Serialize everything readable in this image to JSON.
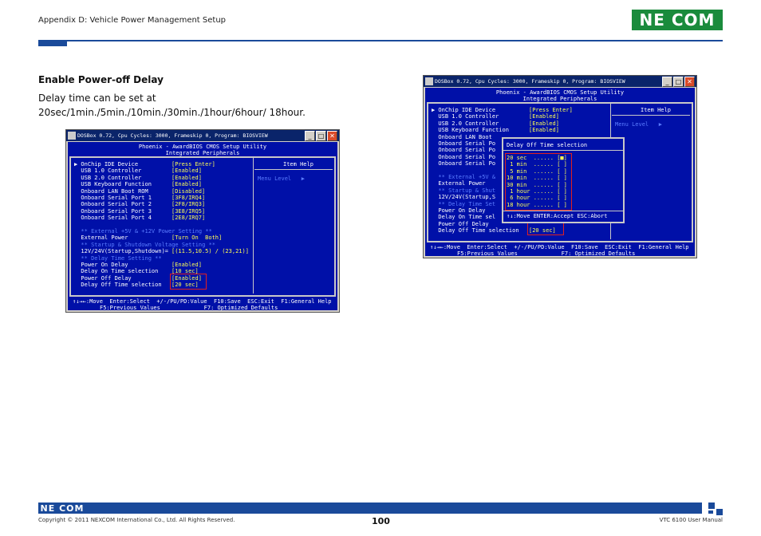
{
  "header": {
    "section": "Appendix D: Vehicle Power Management Setup",
    "logo_text": "NE COM",
    "logo_x": "X"
  },
  "content": {
    "title": "Enable Power-off Delay",
    "body": "Delay time can be set at 20sec/1min./5min./10min./30min./1hour/6hour/ 18hour."
  },
  "dos_window": {
    "title": "DOSBox 0.72, Cpu Cycles:   3000, Frameskip 0, Program: BIOSVIEW",
    "bios_title": "Phoenix - AwardBIOS CMOS Setup Utility",
    "bios_subtitle": "Integrated Peripherals",
    "item_help": "Item Help",
    "menu_level": "Menu Level   ▶",
    "help1": "↑↓→←:Move  Enter:Select  +/-/PU/PD:Value  F10:Save  ESC:Exit  F1:General Help",
    "help2": "F5:Previous Values             F7: Optimized Defaults"
  },
  "left_items": [
    {
      "label": "▶ OnChip IDE Device",
      "value": "[Press Enter]",
      "lcolor": "white",
      "vcolor": "yellow"
    },
    {
      "label": "  USB 1.0 Controller",
      "value": "[Enabled]",
      "lcolor": "white",
      "vcolor": "yellow"
    },
    {
      "label": "  USB 2.0 Controller",
      "value": "[Enabled]",
      "lcolor": "white",
      "vcolor": "yellow"
    },
    {
      "label": "  USB Keyboard Function",
      "value": "[Enabled]",
      "lcolor": "white",
      "vcolor": "yellow"
    },
    {
      "label": "  Onboard LAN Boot ROM",
      "value": "[Disabled]",
      "lcolor": "white",
      "vcolor": "yellow"
    },
    {
      "label": "  Onboard Serial Port 1",
      "value": "[3F8/IRQ4]",
      "lcolor": "white",
      "vcolor": "yellow"
    },
    {
      "label": "  Onboard Serial Port 2",
      "value": "[2F8/IRQ3]",
      "lcolor": "white",
      "vcolor": "yellow"
    },
    {
      "label": "  Onboard Serial Port 3",
      "value": "[3E8/IRQ5]",
      "lcolor": "white",
      "vcolor": "yellow"
    },
    {
      "label": "  Onboard Serial Port 4",
      "value": "[2E8/IRQ7]",
      "lcolor": "white",
      "vcolor": "yellow"
    },
    {
      "label": "",
      "value": "",
      "lcolor": "white",
      "vcolor": "yellow"
    },
    {
      "label": "  ** External +5V & +12V Power Setting **",
      "value": "",
      "lcolor": "blue",
      "vcolor": "yellow"
    },
    {
      "label": "  External Power",
      "value": "[Turn On  Both]",
      "lcolor": "white",
      "vcolor": "yellow"
    },
    {
      "label": "  ** Startup & Shutdown Voltage Setting **",
      "value": "",
      "lcolor": "blue",
      "vcolor": "yellow"
    },
    {
      "label": "  12V/24V(Startup,Shutdown)=",
      "value": "[(11.5,10.5) / (23,21)]",
      "lcolor": "white",
      "vcolor": "yellow"
    },
    {
      "label": "  ** Delay Time Setting **",
      "value": "",
      "lcolor": "blue",
      "vcolor": "yellow"
    },
    {
      "label": "  Power On Delay",
      "value": "[Enabled]",
      "lcolor": "white",
      "vcolor": "yellow"
    },
    {
      "label": "  Delay On Time selection",
      "value": "[10 sec]",
      "lcolor": "white",
      "vcolor": "yellow"
    },
    {
      "label": "  Power Off Delay",
      "value": "[Enabled]",
      "lcolor": "white",
      "vcolor": "yellow"
    },
    {
      "label": "  Delay Off Time selection",
      "value": "[20 sec]",
      "lcolor": "white",
      "vcolor": "yellow"
    }
  ],
  "right_items": [
    {
      "label": "▶ OnChip IDE Device",
      "value": "[Press Enter]",
      "lcolor": "white",
      "vcolor": "yellow"
    },
    {
      "label": "  USB 1.0 Controller",
      "value": "[Enabled]",
      "lcolor": "white",
      "vcolor": "yellow"
    },
    {
      "label": "  USB 2.0 Controller",
      "value": "[Enabled]",
      "lcolor": "white",
      "vcolor": "yellow"
    },
    {
      "label": "  USB Keyboard Function",
      "value": "[Enabled]",
      "lcolor": "white",
      "vcolor": "yellow"
    },
    {
      "label": "  Onboard LAN Boot",
      "value": "",
      "lcolor": "white",
      "vcolor": "yellow"
    },
    {
      "label": "  Onboard Serial Po",
      "value": "",
      "lcolor": "white",
      "vcolor": "yellow"
    },
    {
      "label": "  Onboard Serial Po",
      "value": "",
      "lcolor": "white",
      "vcolor": "yellow"
    },
    {
      "label": "  Onboard Serial Po",
      "value": "",
      "lcolor": "white",
      "vcolor": "yellow"
    },
    {
      "label": "  Onboard Serial Po",
      "value": "",
      "lcolor": "white",
      "vcolor": "yellow"
    },
    {
      "label": "",
      "value": "",
      "lcolor": "white",
      "vcolor": "yellow"
    },
    {
      "label": "  ** External +5V &",
      "value": "",
      "lcolor": "blue",
      "vcolor": "yellow"
    },
    {
      "label": "  External Power",
      "value": "",
      "lcolor": "white",
      "vcolor": "yellow"
    },
    {
      "label": "  ** Startup & Shut",
      "value": "",
      "lcolor": "blue",
      "vcolor": "yellow"
    },
    {
      "label": "  12V/24V(Startup,S",
      "value": "",
      "lcolor": "white",
      "vcolor": "yellow"
    },
    {
      "label": "  ** Delay Time Set",
      "value": "",
      "lcolor": "blue",
      "vcolor": "yellow"
    },
    {
      "label": "  Power On Delay",
      "value": "",
      "lcolor": "white",
      "vcolor": "yellow"
    },
    {
      "label": "  Delay On Time sel",
      "value": "",
      "lcolor": "white",
      "vcolor": "yellow"
    },
    {
      "label": "  Power Off Delay",
      "value": "",
      "lcolor": "white",
      "vcolor": "yellow"
    },
    {
      "label": "  Delay Off Time selection",
      "value": "[20 sec]",
      "lcolor": "white",
      "vcolor": "yellow"
    }
  ],
  "popup": {
    "title": "Delay Off Time selection",
    "options": [
      "20 sec  ...... [■]",
      " 1 min  ...... [ ]",
      " 5 min  ...... [ ]",
      "10 min  ...... [ ]",
      "30 min  ...... [ ]",
      " 1 hour ...... [ ]",
      " 6 hour ...... [ ]",
      "18 hour ...... [ ]"
    ],
    "footer": "↑↓:Move ENTER:Accept ESC:Abort"
  },
  "footer": {
    "copyright": "Copyright © 2011 NEXCOM International Co., Ltd. All Rights Reserved.",
    "page": "100",
    "manual": "VTC 6100 User Manual"
  },
  "colors": {
    "accent_blue": "#1a4a9a",
    "nexcom_green": "#1a8b3c",
    "bios_blue": "#0010a8"
  }
}
